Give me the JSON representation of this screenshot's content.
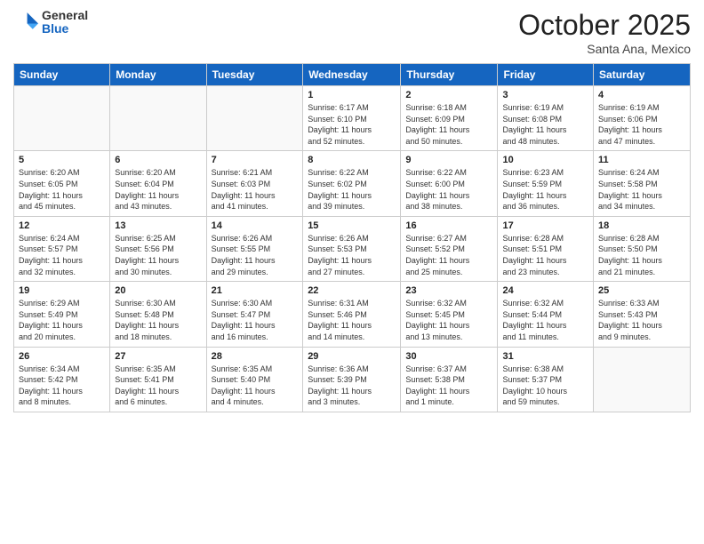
{
  "header": {
    "logo_general": "General",
    "logo_blue": "Blue",
    "month_title": "October 2025",
    "location": "Santa Ana, Mexico"
  },
  "days_of_week": [
    "Sunday",
    "Monday",
    "Tuesday",
    "Wednesday",
    "Thursday",
    "Friday",
    "Saturday"
  ],
  "weeks": [
    [
      {
        "day": "",
        "info": ""
      },
      {
        "day": "",
        "info": ""
      },
      {
        "day": "",
        "info": ""
      },
      {
        "day": "1",
        "info": "Sunrise: 6:17 AM\nSunset: 6:10 PM\nDaylight: 11 hours\nand 52 minutes."
      },
      {
        "day": "2",
        "info": "Sunrise: 6:18 AM\nSunset: 6:09 PM\nDaylight: 11 hours\nand 50 minutes."
      },
      {
        "day": "3",
        "info": "Sunrise: 6:19 AM\nSunset: 6:08 PM\nDaylight: 11 hours\nand 48 minutes."
      },
      {
        "day": "4",
        "info": "Sunrise: 6:19 AM\nSunset: 6:06 PM\nDaylight: 11 hours\nand 47 minutes."
      }
    ],
    [
      {
        "day": "5",
        "info": "Sunrise: 6:20 AM\nSunset: 6:05 PM\nDaylight: 11 hours\nand 45 minutes."
      },
      {
        "day": "6",
        "info": "Sunrise: 6:20 AM\nSunset: 6:04 PM\nDaylight: 11 hours\nand 43 minutes."
      },
      {
        "day": "7",
        "info": "Sunrise: 6:21 AM\nSunset: 6:03 PM\nDaylight: 11 hours\nand 41 minutes."
      },
      {
        "day": "8",
        "info": "Sunrise: 6:22 AM\nSunset: 6:02 PM\nDaylight: 11 hours\nand 39 minutes."
      },
      {
        "day": "9",
        "info": "Sunrise: 6:22 AM\nSunset: 6:00 PM\nDaylight: 11 hours\nand 38 minutes."
      },
      {
        "day": "10",
        "info": "Sunrise: 6:23 AM\nSunset: 5:59 PM\nDaylight: 11 hours\nand 36 minutes."
      },
      {
        "day": "11",
        "info": "Sunrise: 6:24 AM\nSunset: 5:58 PM\nDaylight: 11 hours\nand 34 minutes."
      }
    ],
    [
      {
        "day": "12",
        "info": "Sunrise: 6:24 AM\nSunset: 5:57 PM\nDaylight: 11 hours\nand 32 minutes."
      },
      {
        "day": "13",
        "info": "Sunrise: 6:25 AM\nSunset: 5:56 PM\nDaylight: 11 hours\nand 30 minutes."
      },
      {
        "day": "14",
        "info": "Sunrise: 6:26 AM\nSunset: 5:55 PM\nDaylight: 11 hours\nand 29 minutes."
      },
      {
        "day": "15",
        "info": "Sunrise: 6:26 AM\nSunset: 5:53 PM\nDaylight: 11 hours\nand 27 minutes."
      },
      {
        "day": "16",
        "info": "Sunrise: 6:27 AM\nSunset: 5:52 PM\nDaylight: 11 hours\nand 25 minutes."
      },
      {
        "day": "17",
        "info": "Sunrise: 6:28 AM\nSunset: 5:51 PM\nDaylight: 11 hours\nand 23 minutes."
      },
      {
        "day": "18",
        "info": "Sunrise: 6:28 AM\nSunset: 5:50 PM\nDaylight: 11 hours\nand 21 minutes."
      }
    ],
    [
      {
        "day": "19",
        "info": "Sunrise: 6:29 AM\nSunset: 5:49 PM\nDaylight: 11 hours\nand 20 minutes."
      },
      {
        "day": "20",
        "info": "Sunrise: 6:30 AM\nSunset: 5:48 PM\nDaylight: 11 hours\nand 18 minutes."
      },
      {
        "day": "21",
        "info": "Sunrise: 6:30 AM\nSunset: 5:47 PM\nDaylight: 11 hours\nand 16 minutes."
      },
      {
        "day": "22",
        "info": "Sunrise: 6:31 AM\nSunset: 5:46 PM\nDaylight: 11 hours\nand 14 minutes."
      },
      {
        "day": "23",
        "info": "Sunrise: 6:32 AM\nSunset: 5:45 PM\nDaylight: 11 hours\nand 13 minutes."
      },
      {
        "day": "24",
        "info": "Sunrise: 6:32 AM\nSunset: 5:44 PM\nDaylight: 11 hours\nand 11 minutes."
      },
      {
        "day": "25",
        "info": "Sunrise: 6:33 AM\nSunset: 5:43 PM\nDaylight: 11 hours\nand 9 minutes."
      }
    ],
    [
      {
        "day": "26",
        "info": "Sunrise: 6:34 AM\nSunset: 5:42 PM\nDaylight: 11 hours\nand 8 minutes."
      },
      {
        "day": "27",
        "info": "Sunrise: 6:35 AM\nSunset: 5:41 PM\nDaylight: 11 hours\nand 6 minutes."
      },
      {
        "day": "28",
        "info": "Sunrise: 6:35 AM\nSunset: 5:40 PM\nDaylight: 11 hours\nand 4 minutes."
      },
      {
        "day": "29",
        "info": "Sunrise: 6:36 AM\nSunset: 5:39 PM\nDaylight: 11 hours\nand 3 minutes."
      },
      {
        "day": "30",
        "info": "Sunrise: 6:37 AM\nSunset: 5:38 PM\nDaylight: 11 hours\nand 1 minute."
      },
      {
        "day": "31",
        "info": "Sunrise: 6:38 AM\nSunset: 5:37 PM\nDaylight: 10 hours\nand 59 minutes."
      },
      {
        "day": "",
        "info": ""
      }
    ]
  ]
}
